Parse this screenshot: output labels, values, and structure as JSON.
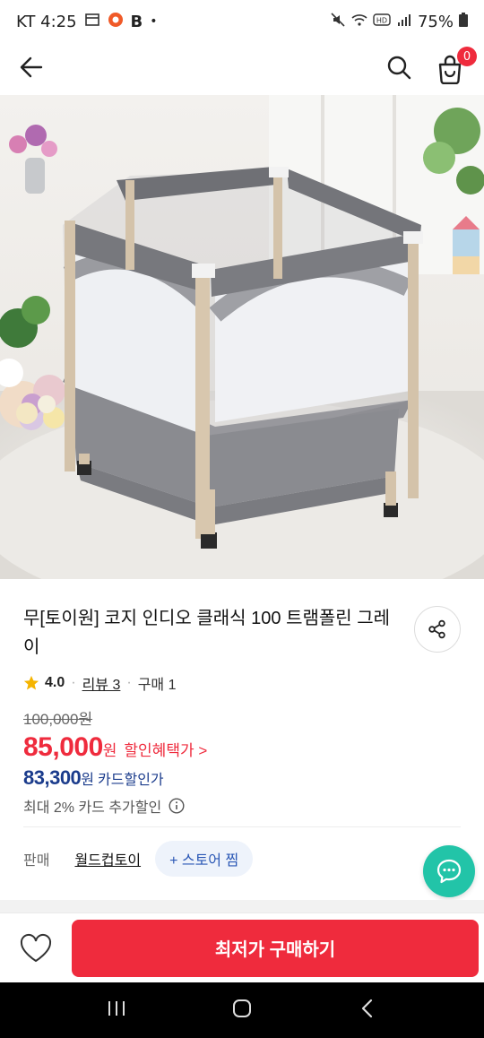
{
  "status_bar": {
    "carrier_time": "KT 4:25",
    "app_letter": "B",
    "dot": "•",
    "battery": "75%"
  },
  "nav": {
    "cart_badge": "0"
  },
  "product": {
    "title": "무[토이원] 코지 인디오 클래식 100 트램폴린 그레이",
    "rating_value": "4.0",
    "reviews": "리뷰 3",
    "purchases": "구매 1",
    "original_price": "100,000원",
    "sale_price": "85,000",
    "sale_unit": "원",
    "discount_link": "할인혜택가 >",
    "card_price": "83,300",
    "card_unit": "원",
    "card_label": "카드할인가",
    "max_discount": "최대 2% 카드 추가할인"
  },
  "seller": {
    "label": "판매",
    "name": "월드컵토이",
    "store_button": "+ 스토어 찜"
  },
  "bottom": {
    "buy_button": "최저가 구매하기"
  },
  "colors": {
    "accent_red": "#ef2b3d",
    "card_blue": "#1b3c8c",
    "chat_green": "#22c4a8"
  }
}
